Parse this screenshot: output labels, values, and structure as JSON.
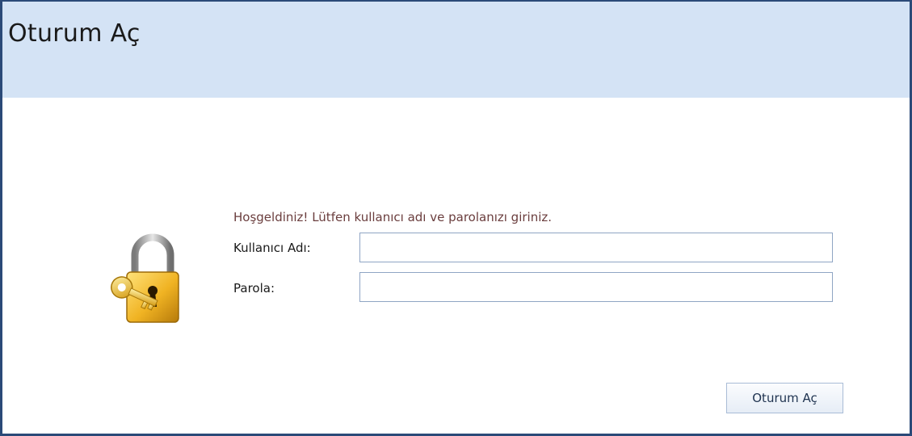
{
  "header": {
    "title": "Oturum Aç"
  },
  "login": {
    "welcome": "Hoşgeldiniz! Lütfen kullanıcı adı ve parolanızı giriniz.",
    "username_label": "Kullanıcı Adı:",
    "username_value": "",
    "password_label": "Parola:",
    "password_value": "",
    "submit_label": "Oturum Aç",
    "icon": "lock-key-icon"
  },
  "colors": {
    "frame_border": "#2b4a78",
    "header_bg": "#d4e3f5",
    "welcome_text": "#6a3d3d",
    "field_border": "#8fa5c4"
  }
}
